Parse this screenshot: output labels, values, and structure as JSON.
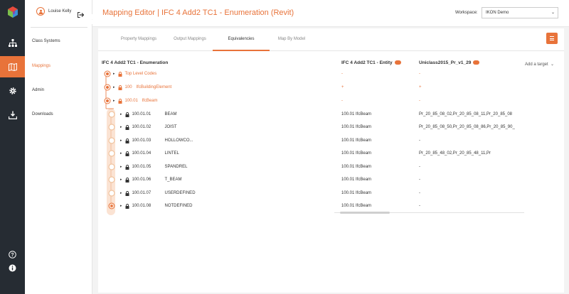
{
  "sidebar": {
    "user_name": "Louise Kelly",
    "items": [
      {
        "label": "Class Systems"
      },
      {
        "label": "Mappings"
      },
      {
        "label": "Admin"
      },
      {
        "label": "Downloads"
      }
    ]
  },
  "header": {
    "title": "Mapping Editor | IFC 4 Add2 TC1 - Enumeration (Revit)",
    "workspace_label": "Workspace:",
    "workspace_value": "IKON Demo"
  },
  "tabs": [
    {
      "label": "Property Mappings"
    },
    {
      "label": "Output Mappings"
    },
    {
      "label": "Equivalencies"
    },
    {
      "label": "Map By Model"
    }
  ],
  "columns": {
    "source": "IFC 4 Add2 TC1 - Enumeration",
    "target1": "IFC 4 Add2 TC1 - Entity",
    "target2": "Uniclass2015_Pr_v1_29",
    "add_target": "Add a target"
  },
  "rows": [
    {
      "code": "",
      "name": "Top Level Codes",
      "entity": "-",
      "uniclass": "-"
    },
    {
      "code": "100",
      "name": "IfcBuildingElement",
      "entity": "+",
      "uniclass": "+"
    },
    {
      "code": "100.01",
      "name": "IfcBeam",
      "entity": "-",
      "uniclass": "-"
    },
    {
      "code": "100.01.01",
      "name": "BEAM",
      "entity": "100.01  IfcBeam",
      "uniclass": "Pr_20_85_08_02,Pr_20_85_08_11,Pr_20_85_08"
    },
    {
      "code": "100.01.02",
      "name": "JOIST",
      "entity": "100.01  IfcBeam",
      "uniclass": "Pr_20_85_08_50,Pr_20_85_08_86,Pr_20_85_90_"
    },
    {
      "code": "100.01.03",
      "name": "HOLLOWCO...",
      "entity": "100.01  IfcBeam",
      "uniclass": "-"
    },
    {
      "code": "100.01.04",
      "name": "LINTEL",
      "entity": "100.01  IfcBeam",
      "uniclass": "Pr_20_85_48_02,Pr_20_85_48_11,Pr"
    },
    {
      "code": "100.01.05",
      "name": "SPANDREL",
      "entity": "100.01  IfcBeam",
      "uniclass": "-"
    },
    {
      "code": "100.01.06",
      "name": "T_BEAM",
      "entity": "100.01  IfcBeam",
      "uniclass": "-"
    },
    {
      "code": "100.01.07",
      "name": "USERDEFINED",
      "entity": "100.01  IfcBeam",
      "uniclass": "-"
    },
    {
      "code": "100.01.08",
      "name": "NOTDEFINED",
      "entity": "100.01  IfcBeam",
      "uniclass": "-"
    }
  ],
  "colors": {
    "accent": "#e8733a",
    "rail": "#262c33"
  }
}
